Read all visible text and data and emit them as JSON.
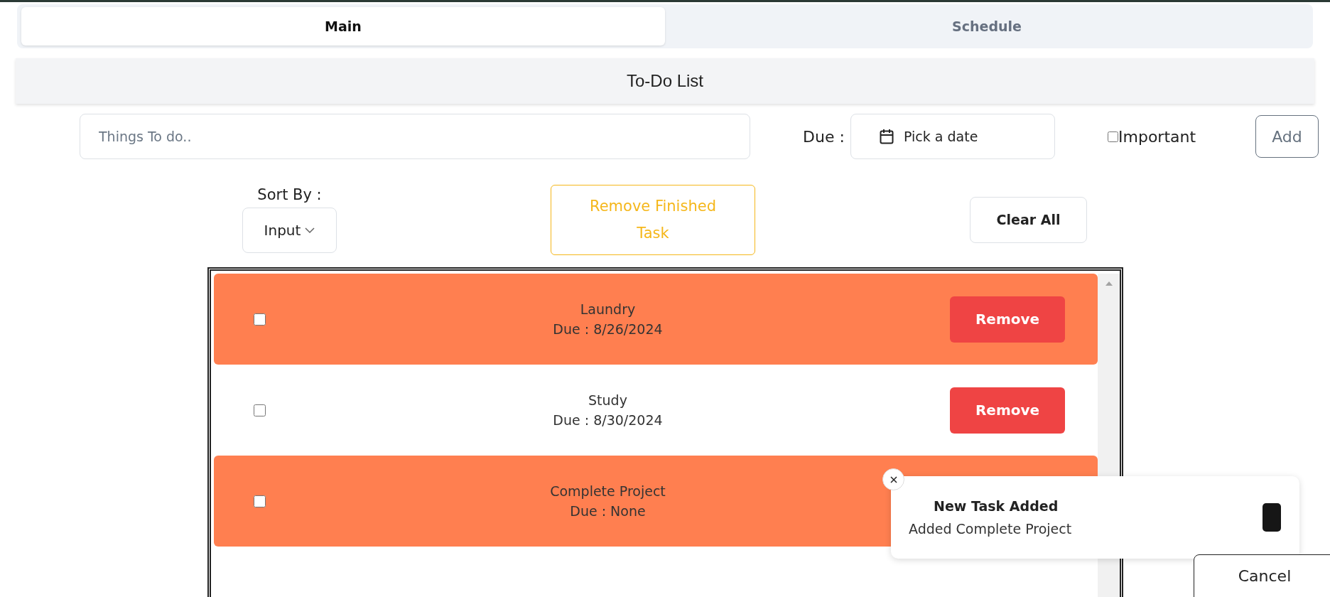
{
  "tabs": [
    {
      "label": "Main",
      "selected": true
    },
    {
      "label": "Schedule",
      "selected": false
    }
  ],
  "header": {
    "title": "To-Do List"
  },
  "new_task": {
    "placeholder": "Things To do..",
    "due_label": "Due :",
    "date_button": "Pick a date",
    "important": {
      "label": "Important",
      "checked": false
    },
    "add_button": "Add"
  },
  "controls": {
    "sort_label": "Sort By :",
    "sort_value": "Input",
    "remove_finished_button": "Remove Finished Task",
    "clear_all_button": "Clear All"
  },
  "tasks": [
    {
      "name": "Laundry",
      "due": "Due : 8/26/2024",
      "checked": false,
      "important": true,
      "remove_button": "Remove"
    },
    {
      "name": "Study",
      "due": "Due : 8/30/2024",
      "checked": false,
      "important": false,
      "remove_button": "Remove"
    },
    {
      "name": "Complete Project",
      "due": "Due : None",
      "checked": false,
      "important": true
    }
  ],
  "toast": {
    "title": "New Task Added",
    "message": "Added Complete Project"
  },
  "cancel_button": "Cancel"
}
